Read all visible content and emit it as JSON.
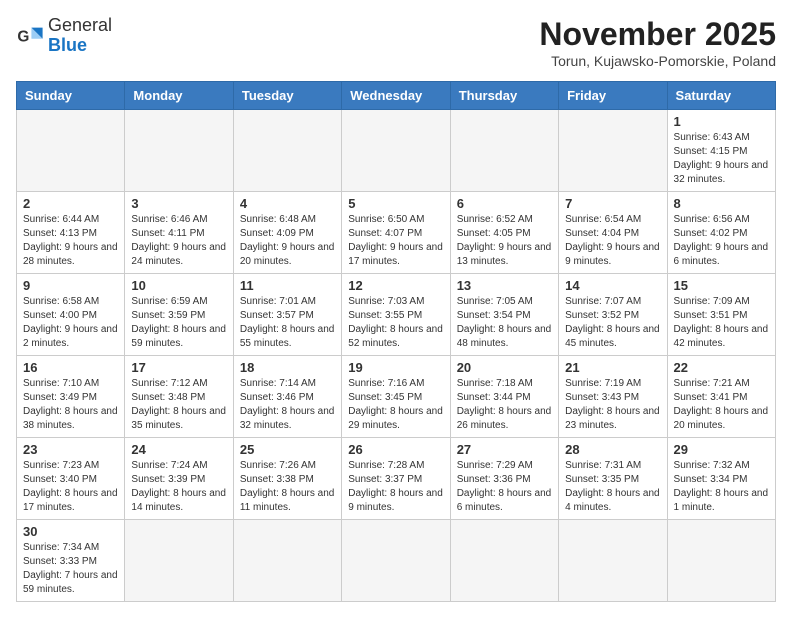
{
  "header": {
    "logo_general": "General",
    "logo_blue": "Blue",
    "month_title": "November 2025",
    "subtitle": "Torun, Kujawsko-Pomorskie, Poland"
  },
  "weekdays": [
    "Sunday",
    "Monday",
    "Tuesday",
    "Wednesday",
    "Thursday",
    "Friday",
    "Saturday"
  ],
  "weeks": [
    [
      {
        "day": "",
        "info": ""
      },
      {
        "day": "",
        "info": ""
      },
      {
        "day": "",
        "info": ""
      },
      {
        "day": "",
        "info": ""
      },
      {
        "day": "",
        "info": ""
      },
      {
        "day": "",
        "info": ""
      },
      {
        "day": "1",
        "info": "Sunrise: 6:43 AM\nSunset: 4:15 PM\nDaylight: 9 hours and 32 minutes."
      }
    ],
    [
      {
        "day": "2",
        "info": "Sunrise: 6:44 AM\nSunset: 4:13 PM\nDaylight: 9 hours and 28 minutes."
      },
      {
        "day": "3",
        "info": "Sunrise: 6:46 AM\nSunset: 4:11 PM\nDaylight: 9 hours and 24 minutes."
      },
      {
        "day": "4",
        "info": "Sunrise: 6:48 AM\nSunset: 4:09 PM\nDaylight: 9 hours and 20 minutes."
      },
      {
        "day": "5",
        "info": "Sunrise: 6:50 AM\nSunset: 4:07 PM\nDaylight: 9 hours and 17 minutes."
      },
      {
        "day": "6",
        "info": "Sunrise: 6:52 AM\nSunset: 4:05 PM\nDaylight: 9 hours and 13 minutes."
      },
      {
        "day": "7",
        "info": "Sunrise: 6:54 AM\nSunset: 4:04 PM\nDaylight: 9 hours and 9 minutes."
      },
      {
        "day": "8",
        "info": "Sunrise: 6:56 AM\nSunset: 4:02 PM\nDaylight: 9 hours and 6 minutes."
      }
    ],
    [
      {
        "day": "9",
        "info": "Sunrise: 6:58 AM\nSunset: 4:00 PM\nDaylight: 9 hours and 2 minutes."
      },
      {
        "day": "10",
        "info": "Sunrise: 6:59 AM\nSunset: 3:59 PM\nDaylight: 8 hours and 59 minutes."
      },
      {
        "day": "11",
        "info": "Sunrise: 7:01 AM\nSunset: 3:57 PM\nDaylight: 8 hours and 55 minutes."
      },
      {
        "day": "12",
        "info": "Sunrise: 7:03 AM\nSunset: 3:55 PM\nDaylight: 8 hours and 52 minutes."
      },
      {
        "day": "13",
        "info": "Sunrise: 7:05 AM\nSunset: 3:54 PM\nDaylight: 8 hours and 48 minutes."
      },
      {
        "day": "14",
        "info": "Sunrise: 7:07 AM\nSunset: 3:52 PM\nDaylight: 8 hours and 45 minutes."
      },
      {
        "day": "15",
        "info": "Sunrise: 7:09 AM\nSunset: 3:51 PM\nDaylight: 8 hours and 42 minutes."
      }
    ],
    [
      {
        "day": "16",
        "info": "Sunrise: 7:10 AM\nSunset: 3:49 PM\nDaylight: 8 hours and 38 minutes."
      },
      {
        "day": "17",
        "info": "Sunrise: 7:12 AM\nSunset: 3:48 PM\nDaylight: 8 hours and 35 minutes."
      },
      {
        "day": "18",
        "info": "Sunrise: 7:14 AM\nSunset: 3:46 PM\nDaylight: 8 hours and 32 minutes."
      },
      {
        "day": "19",
        "info": "Sunrise: 7:16 AM\nSunset: 3:45 PM\nDaylight: 8 hours and 29 minutes."
      },
      {
        "day": "20",
        "info": "Sunrise: 7:18 AM\nSunset: 3:44 PM\nDaylight: 8 hours and 26 minutes."
      },
      {
        "day": "21",
        "info": "Sunrise: 7:19 AM\nSunset: 3:43 PM\nDaylight: 8 hours and 23 minutes."
      },
      {
        "day": "22",
        "info": "Sunrise: 7:21 AM\nSunset: 3:41 PM\nDaylight: 8 hours and 20 minutes."
      }
    ],
    [
      {
        "day": "23",
        "info": "Sunrise: 7:23 AM\nSunset: 3:40 PM\nDaylight: 8 hours and 17 minutes."
      },
      {
        "day": "24",
        "info": "Sunrise: 7:24 AM\nSunset: 3:39 PM\nDaylight: 8 hours and 14 minutes."
      },
      {
        "day": "25",
        "info": "Sunrise: 7:26 AM\nSunset: 3:38 PM\nDaylight: 8 hours and 11 minutes."
      },
      {
        "day": "26",
        "info": "Sunrise: 7:28 AM\nSunset: 3:37 PM\nDaylight: 8 hours and 9 minutes."
      },
      {
        "day": "27",
        "info": "Sunrise: 7:29 AM\nSunset: 3:36 PM\nDaylight: 8 hours and 6 minutes."
      },
      {
        "day": "28",
        "info": "Sunrise: 7:31 AM\nSunset: 3:35 PM\nDaylight: 8 hours and 4 minutes."
      },
      {
        "day": "29",
        "info": "Sunrise: 7:32 AM\nSunset: 3:34 PM\nDaylight: 8 hours and 1 minute."
      }
    ],
    [
      {
        "day": "30",
        "info": "Sunrise: 7:34 AM\nSunset: 3:33 PM\nDaylight: 7 hours and 59 minutes."
      },
      {
        "day": "",
        "info": ""
      },
      {
        "day": "",
        "info": ""
      },
      {
        "day": "",
        "info": ""
      },
      {
        "day": "",
        "info": ""
      },
      {
        "day": "",
        "info": ""
      },
      {
        "day": "",
        "info": ""
      }
    ]
  ]
}
